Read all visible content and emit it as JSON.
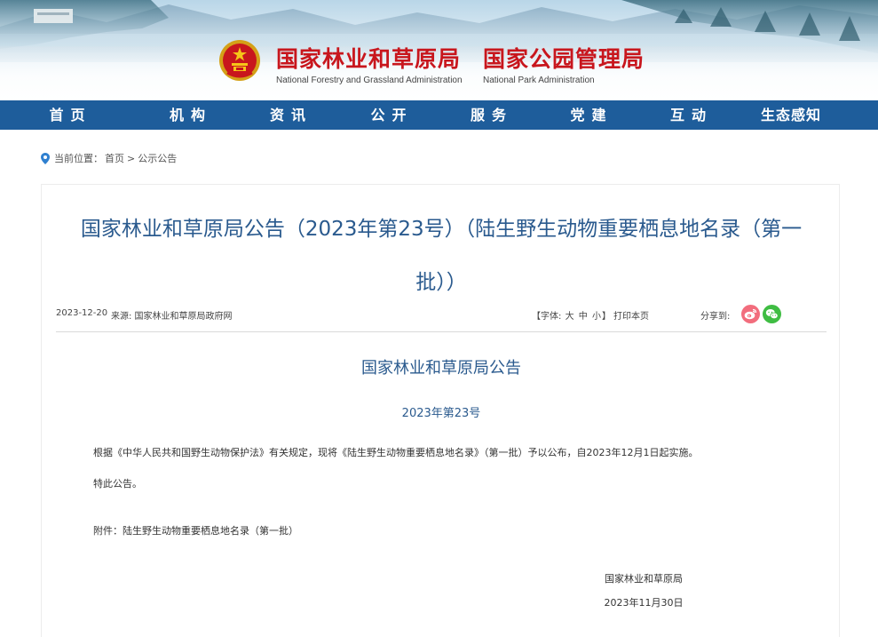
{
  "header": {
    "name_forestry": "国家林业和草原局",
    "name_forestry_en": "National Forestry and Grassland Administration",
    "name_park": "国家公园管理局",
    "name_park_en": "National Park Administration",
    "emblem_icon": "national-emblem-icon",
    "title_color": "#c8161d"
  },
  "nav": {
    "color": "#1e5d9b",
    "items": [
      "首页",
      "机构",
      "资讯",
      "公开",
      "服务",
      "党建",
      "互动",
      "生态感知"
    ]
  },
  "breadcrumb": {
    "prefix": "当前位置：",
    "home": "首页",
    "separator": ">",
    "current": "公示公告"
  },
  "article": {
    "title_line1": "国家林业和草原局公告（2023年第23号）（陆生野生动物重要栖息地名录（第一",
    "title_line2": "批））",
    "date": "2023-12-20",
    "source": "来源:  国家林业和草原局政府网",
    "font_label": "【字体:",
    "font_large": "大",
    "font_medium": "中",
    "font_small": "小",
    "font_close": "】",
    "print": "打印本页",
    "share_label": "分享到:",
    "share_icons": [
      "weibo-icon",
      "wechat-icon"
    ],
    "heading": "国家林业和草原局公告",
    "number": "2023年第23号",
    "body_p1": "根据《中华人民共和国野生动物保护法》有关规定，现将《陆生野生动物重要栖息地名录》（第一批）予以公布，自2023年12月1日起实施。",
    "body_p2": "特此公告。",
    "attachment": "附件：陆生野生动物重要栖息地名录（第一批）",
    "signature": "国家林业和草原局",
    "sign_date": "2023年11月30日",
    "title_color": "#2a5a8e"
  }
}
